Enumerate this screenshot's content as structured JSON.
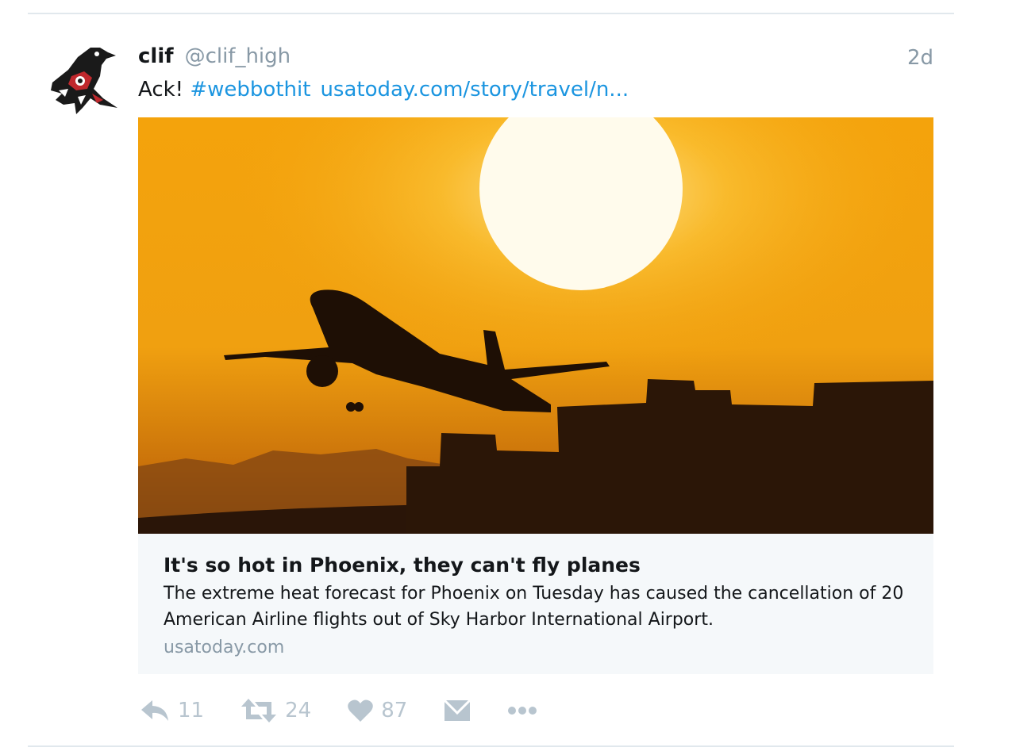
{
  "tweet": {
    "author_name": "clif",
    "author_handle": "@clif_high",
    "timestamp": "2d",
    "text_prefix": "Ack! ",
    "hashtag": "#webbothit",
    "link": "usatoday.com/story/travel/n..."
  },
  "card": {
    "title": "It's so hot in Phoenix, they can't fly planes",
    "description": "The extreme heat forecast for Phoenix on Tuesday has caused the cancellation of 20 American Airline flights out of Sky Harbor International Airport.",
    "domain": "usatoday.com"
  },
  "actions": {
    "reply_count": "11",
    "retweet_count": "24",
    "like_count": "87"
  },
  "icons": {
    "avatar": "raven-logo-icon",
    "reply": "reply-icon",
    "retweet": "retweet-icon",
    "like": "heart-icon",
    "message": "envelope-icon",
    "more": "more-dots-icon"
  },
  "colors": {
    "link": "#1b95e0",
    "muted": "#8899a6",
    "action": "#b8c5cf",
    "card_bg": "#f5f8fa"
  }
}
